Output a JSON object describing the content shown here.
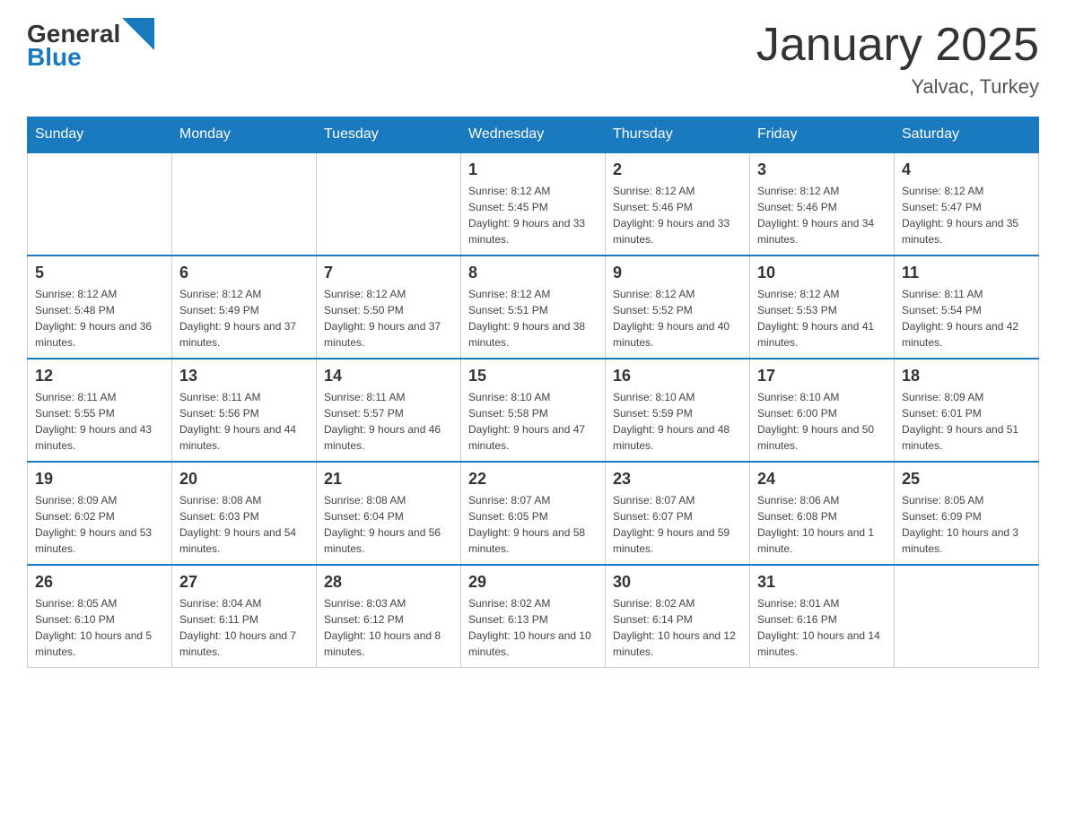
{
  "header": {
    "logo": {
      "text_general": "General",
      "text_blue": "Blue"
    },
    "title": "January 2025",
    "subtitle": "Yalvac, Turkey"
  },
  "days_of_week": [
    "Sunday",
    "Monday",
    "Tuesday",
    "Wednesday",
    "Thursday",
    "Friday",
    "Saturday"
  ],
  "weeks": [
    [
      {
        "day": "",
        "info": ""
      },
      {
        "day": "",
        "info": ""
      },
      {
        "day": "",
        "info": ""
      },
      {
        "day": "1",
        "info": "Sunrise: 8:12 AM\nSunset: 5:45 PM\nDaylight: 9 hours and 33 minutes."
      },
      {
        "day": "2",
        "info": "Sunrise: 8:12 AM\nSunset: 5:46 PM\nDaylight: 9 hours and 33 minutes."
      },
      {
        "day": "3",
        "info": "Sunrise: 8:12 AM\nSunset: 5:46 PM\nDaylight: 9 hours and 34 minutes."
      },
      {
        "day": "4",
        "info": "Sunrise: 8:12 AM\nSunset: 5:47 PM\nDaylight: 9 hours and 35 minutes."
      }
    ],
    [
      {
        "day": "5",
        "info": "Sunrise: 8:12 AM\nSunset: 5:48 PM\nDaylight: 9 hours and 36 minutes."
      },
      {
        "day": "6",
        "info": "Sunrise: 8:12 AM\nSunset: 5:49 PM\nDaylight: 9 hours and 37 minutes."
      },
      {
        "day": "7",
        "info": "Sunrise: 8:12 AM\nSunset: 5:50 PM\nDaylight: 9 hours and 37 minutes."
      },
      {
        "day": "8",
        "info": "Sunrise: 8:12 AM\nSunset: 5:51 PM\nDaylight: 9 hours and 38 minutes."
      },
      {
        "day": "9",
        "info": "Sunrise: 8:12 AM\nSunset: 5:52 PM\nDaylight: 9 hours and 40 minutes."
      },
      {
        "day": "10",
        "info": "Sunrise: 8:12 AM\nSunset: 5:53 PM\nDaylight: 9 hours and 41 minutes."
      },
      {
        "day": "11",
        "info": "Sunrise: 8:11 AM\nSunset: 5:54 PM\nDaylight: 9 hours and 42 minutes."
      }
    ],
    [
      {
        "day": "12",
        "info": "Sunrise: 8:11 AM\nSunset: 5:55 PM\nDaylight: 9 hours and 43 minutes."
      },
      {
        "day": "13",
        "info": "Sunrise: 8:11 AM\nSunset: 5:56 PM\nDaylight: 9 hours and 44 minutes."
      },
      {
        "day": "14",
        "info": "Sunrise: 8:11 AM\nSunset: 5:57 PM\nDaylight: 9 hours and 46 minutes."
      },
      {
        "day": "15",
        "info": "Sunrise: 8:10 AM\nSunset: 5:58 PM\nDaylight: 9 hours and 47 minutes."
      },
      {
        "day": "16",
        "info": "Sunrise: 8:10 AM\nSunset: 5:59 PM\nDaylight: 9 hours and 48 minutes."
      },
      {
        "day": "17",
        "info": "Sunrise: 8:10 AM\nSunset: 6:00 PM\nDaylight: 9 hours and 50 minutes."
      },
      {
        "day": "18",
        "info": "Sunrise: 8:09 AM\nSunset: 6:01 PM\nDaylight: 9 hours and 51 minutes."
      }
    ],
    [
      {
        "day": "19",
        "info": "Sunrise: 8:09 AM\nSunset: 6:02 PM\nDaylight: 9 hours and 53 minutes."
      },
      {
        "day": "20",
        "info": "Sunrise: 8:08 AM\nSunset: 6:03 PM\nDaylight: 9 hours and 54 minutes."
      },
      {
        "day": "21",
        "info": "Sunrise: 8:08 AM\nSunset: 6:04 PM\nDaylight: 9 hours and 56 minutes."
      },
      {
        "day": "22",
        "info": "Sunrise: 8:07 AM\nSunset: 6:05 PM\nDaylight: 9 hours and 58 minutes."
      },
      {
        "day": "23",
        "info": "Sunrise: 8:07 AM\nSunset: 6:07 PM\nDaylight: 9 hours and 59 minutes."
      },
      {
        "day": "24",
        "info": "Sunrise: 8:06 AM\nSunset: 6:08 PM\nDaylight: 10 hours and 1 minute."
      },
      {
        "day": "25",
        "info": "Sunrise: 8:05 AM\nSunset: 6:09 PM\nDaylight: 10 hours and 3 minutes."
      }
    ],
    [
      {
        "day": "26",
        "info": "Sunrise: 8:05 AM\nSunset: 6:10 PM\nDaylight: 10 hours and 5 minutes."
      },
      {
        "day": "27",
        "info": "Sunrise: 8:04 AM\nSunset: 6:11 PM\nDaylight: 10 hours and 7 minutes."
      },
      {
        "day": "28",
        "info": "Sunrise: 8:03 AM\nSunset: 6:12 PM\nDaylight: 10 hours and 8 minutes."
      },
      {
        "day": "29",
        "info": "Sunrise: 8:02 AM\nSunset: 6:13 PM\nDaylight: 10 hours and 10 minutes."
      },
      {
        "day": "30",
        "info": "Sunrise: 8:02 AM\nSunset: 6:14 PM\nDaylight: 10 hours and 12 minutes."
      },
      {
        "day": "31",
        "info": "Sunrise: 8:01 AM\nSunset: 6:16 PM\nDaylight: 10 hours and 14 minutes."
      },
      {
        "day": "",
        "info": ""
      }
    ]
  ]
}
